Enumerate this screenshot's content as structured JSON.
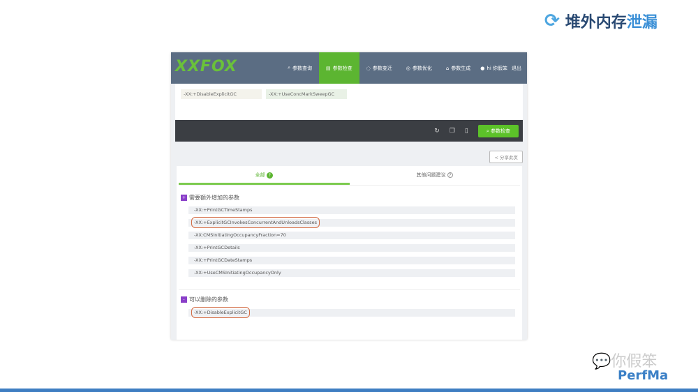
{
  "slide": {
    "title_main": "堆外内存",
    "title_highlight": "泄漏",
    "watermark": "你假笨",
    "brand": "PerfMa"
  },
  "app": {
    "logo": "XXFOX",
    "nav": [
      {
        "label": "参数查询",
        "icon": "search-icon"
      },
      {
        "label": "参数检查",
        "icon": "doc-icon",
        "active": true
      },
      {
        "label": "参数变迁",
        "icon": "refresh-icon"
      },
      {
        "label": "参数优化",
        "icon": "check-circle-icon"
      },
      {
        "label": "参数生成",
        "icon": "build-icon"
      }
    ],
    "user": "hi 你假笨",
    "logout": "退出",
    "input_tags": [
      "-XX:+DisableExplicitGC",
      "-XX:+UseConcMarkSweepGC"
    ],
    "check_button": "参数检查",
    "share_button": "分享此页",
    "tabs": [
      {
        "label": "全部",
        "badge": "?"
      },
      {
        "label": "其他问题建议"
      }
    ],
    "sections": [
      {
        "title": "需要额外增加的参数",
        "icon": "+",
        "items": [
          "-XX:+PrintGCTimeStamps",
          "-XX:+ExplicitGCInvokesConcurrentAndUnloadsClasses",
          "-XX:CMSInitiatingOccupancyFraction=70",
          "-XX:+PrintGCDetails",
          "-XX:+PrintGCDateStamps",
          "-XX:+UseCMSInitiatingOccupancyOnly"
        ],
        "highlight": [
          1
        ]
      },
      {
        "title": "可以删除的参数",
        "icon": "-",
        "items": [
          "-XX:+DisableExplicitGC"
        ],
        "highlight": [
          0
        ]
      }
    ]
  }
}
